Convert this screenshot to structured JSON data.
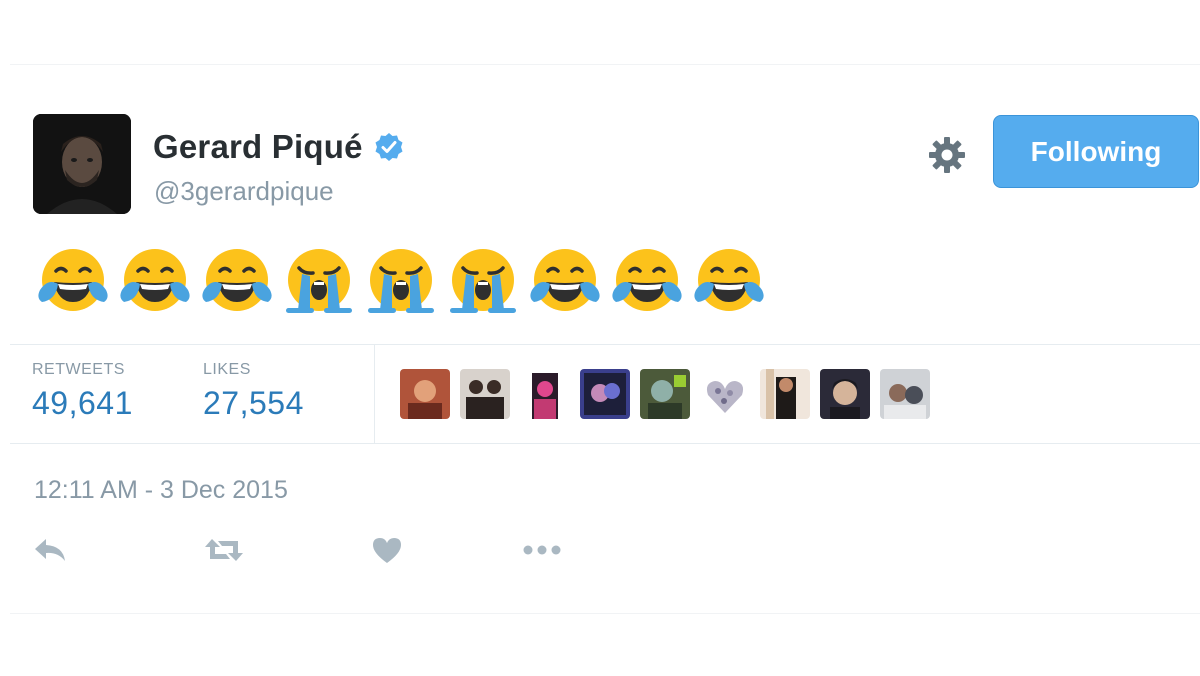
{
  "user": {
    "name": "Gerard Piqué",
    "handle": "@3gerardpique",
    "verified": true
  },
  "follow_button": {
    "label": "Following",
    "color": "#55acee"
  },
  "tweet": {
    "emojis": [
      "face-with-tears-of-joy",
      "face-with-tears-of-joy",
      "face-with-tears-of-joy",
      "loudly-crying-face",
      "loudly-crying-face",
      "loudly-crying-face",
      "face-with-tears-of-joy",
      "face-with-tears-of-joy",
      "face-with-tears-of-joy"
    ]
  },
  "stats": {
    "retweets_label": "RETWEETS",
    "retweets_value": "49,641",
    "likes_label": "LIKES",
    "likes_value": "27,554"
  },
  "likers_count_shown": 9,
  "timestamp": "12:11 AM - 3 Dec 2015",
  "actions": [
    "reply-icon",
    "retweet-icon",
    "like-icon",
    "more-icon"
  ],
  "colors": {
    "link_blue": "#2b7bb9",
    "muted_gray": "#8899a6",
    "text_dark": "#292f33",
    "action_gray": "#aab8c2"
  }
}
